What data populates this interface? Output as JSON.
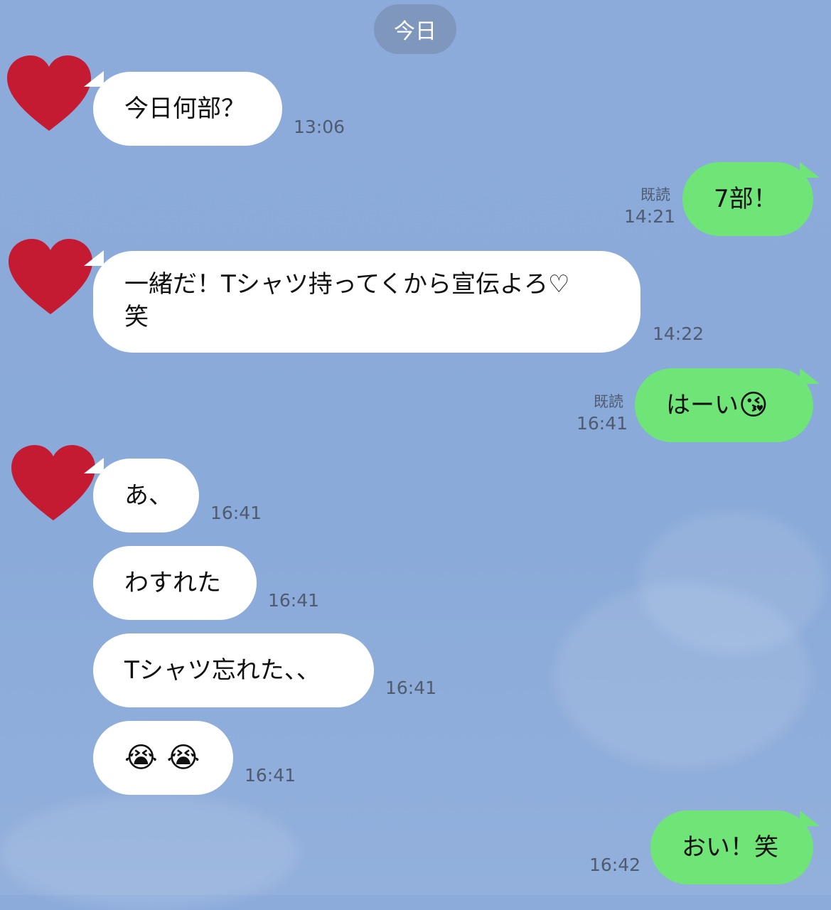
{
  "date_divider": "今日",
  "colors": {
    "background": "#8aaad9",
    "incoming_bubble": "#ffffff",
    "outgoing_bubble": "#6ee576",
    "avatar": "#c41a32"
  },
  "avatar_icon": "red-heart-icon",
  "messages": [
    {
      "dir": "in",
      "text": "今日何部？",
      "time": "13:06"
    },
    {
      "dir": "out",
      "text": "7部！",
      "time": "14:21",
      "read": "既読"
    },
    {
      "dir": "in",
      "line1": "一緒だ！Tシャツ持ってくから宣伝よろ♡",
      "line2": "笑",
      "time": "14:22"
    },
    {
      "dir": "out",
      "text": "はーい",
      "emoji": "😘",
      "time": "16:41",
      "read": "既読"
    },
    {
      "dir": "in",
      "text": "あ、",
      "time": "16:41"
    },
    {
      "dir": "in",
      "text": "わすれた",
      "time": "16:41"
    },
    {
      "dir": "in",
      "text": "Tシャツ忘れた、、",
      "time": "16:41"
    },
    {
      "dir": "in",
      "text": "😭 😭",
      "time": "16:41"
    },
    {
      "dir": "out",
      "text": "おい！笑",
      "time": "16:42"
    }
  ]
}
